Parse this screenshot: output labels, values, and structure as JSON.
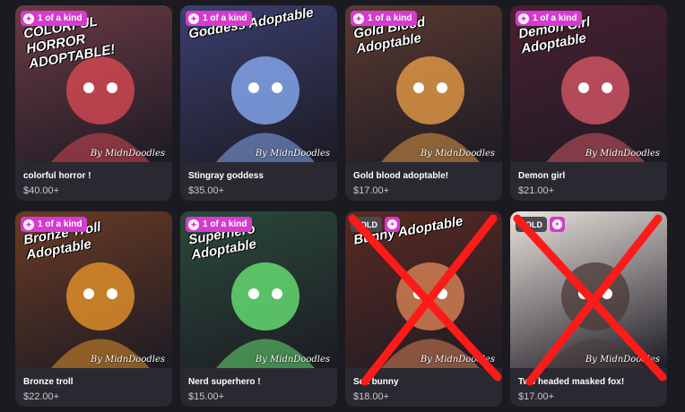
{
  "items": [
    {
      "name": "colorful horror !",
      "price": "$40.00+",
      "badge": "1 of a kind",
      "sold": false,
      "art_text": "COLORFUL HORROR ADOPTABLE!",
      "bg": "#6b3a44",
      "accent": "#e24b55"
    },
    {
      "name": "Stingray goddess",
      "price": "$35.00+",
      "badge": "1 of a kind",
      "sold": false,
      "art_text": "Goddess Adoptable",
      "bg": "#3a3f6e",
      "accent": "#8fb3ff"
    },
    {
      "name": "Gold blood adoptable!",
      "price": "$17.00+",
      "badge": "1 of a kind",
      "sold": false,
      "art_text": "Gold Blood Adoptable",
      "bg": "#5b3a30",
      "accent": "#f2a34a"
    },
    {
      "name": "Demon girl",
      "price": "$21.00+",
      "badge": "1 of a kind",
      "sold": false,
      "art_text": "Demon Girl Adoptable",
      "bg": "#4a2030",
      "accent": "#e0596a"
    },
    {
      "name": "Bronze troll",
      "price": "$22.00+",
      "badge": "1 of a kind",
      "sold": false,
      "art_text": "Bronze Troll Adoptable",
      "bg": "#6a3b24",
      "accent": "#f29a2a"
    },
    {
      "name": "Nerd superhero !",
      "price": "$15.00+",
      "badge": "1 of a kind",
      "sold": false,
      "art_text": "Superhero Adoptable",
      "bg": "#2a4a3a",
      "accent": "#6cf07a"
    },
    {
      "name": "Sea bunny",
      "price": "$18.00+",
      "badge": "SOLD",
      "sold": true,
      "art_text": "Bunny Adoptable",
      "bg": "#5a2a22",
      "accent": "#e58a5a"
    },
    {
      "name": "Two headed masked fox!",
      "price": "$17.00+",
      "badge": "SOLD",
      "sold": true,
      "art_text": "",
      "bg": "#e9e2dc",
      "accent": "#4a3a36"
    }
  ],
  "signature": "By MidnDoodles"
}
